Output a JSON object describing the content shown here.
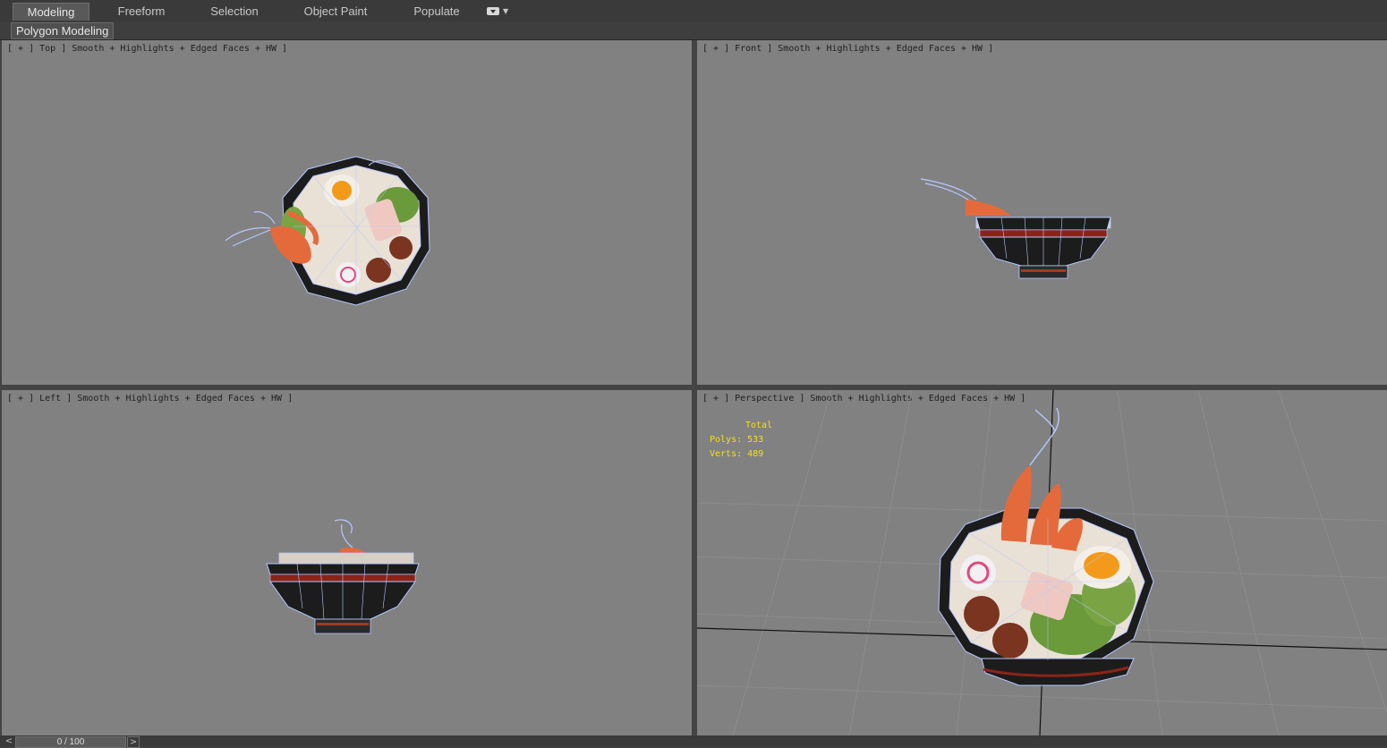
{
  "ribbon": {
    "tabs": [
      {
        "label": "Modeling",
        "active": true
      },
      {
        "label": "Freeform",
        "active": false
      },
      {
        "label": "Selection",
        "active": false
      },
      {
        "label": "Object Paint",
        "active": false
      },
      {
        "label": "Populate",
        "active": false
      }
    ],
    "extra_icon": "dropdown-menu-icon"
  },
  "subribbon": {
    "tab": "Polygon Modeling"
  },
  "viewports": {
    "top": {
      "label": "[ + ] Top ] Smooth + Highlights + Edged Faces + HW ]"
    },
    "front": {
      "label": "[ + ] Front ] Smooth + Highlights + Edged Faces + HW ]"
    },
    "left": {
      "label": "[ + ] Left ] Smooth + Highlights + Edged Faces + HW ]"
    },
    "perspective": {
      "label": "[ + ] Perspective ] Smooth + Highlights + Edged Faces + HW ]",
      "stats": {
        "total": "Total",
        "polys": "Polys: 533",
        "verts": "Verts: 489"
      }
    }
  },
  "timeline": {
    "frame": "0 / 100",
    "prev": "<",
    "next": ">"
  },
  "colors": {
    "viewport_bg": "#818181",
    "ui_bg": "#3a3a3a",
    "stats_text": "#f0e020",
    "wire": "#b8c8ff"
  }
}
